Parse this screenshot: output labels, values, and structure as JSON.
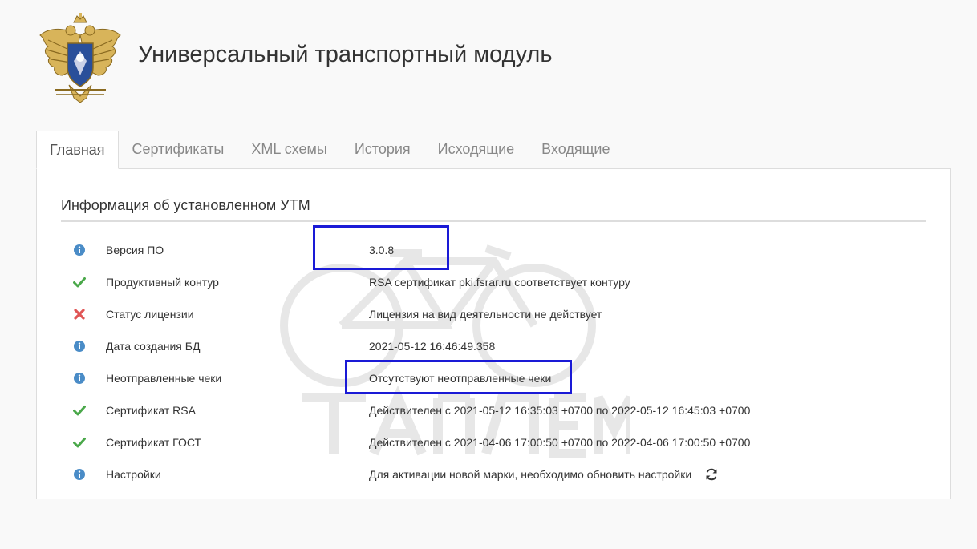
{
  "header": {
    "title": "Универсальный транспортный модуль",
    "emblem_icon": "coat-of-arms-emblem"
  },
  "tabs": [
    {
      "label": "Главная",
      "active": true
    },
    {
      "label": "Сертификаты",
      "active": false
    },
    {
      "label": "XML схемы",
      "active": false
    },
    {
      "label": "История",
      "active": false
    },
    {
      "label": "Исходящие",
      "active": false
    },
    {
      "label": "Входящие",
      "active": false
    }
  ],
  "info": {
    "title": "Информация об установленном УТМ",
    "rows": [
      {
        "icon": "info-icon",
        "label": "Версия ПО",
        "value": "3.0.8"
      },
      {
        "icon": "check-icon",
        "label": "Продуктивный контур",
        "value": "RSA сертификат pki.fsrar.ru соответствует контуру"
      },
      {
        "icon": "cross-icon",
        "label": "Статус лицензии",
        "value": "Лицензия на вид деятельности не действует"
      },
      {
        "icon": "info-icon",
        "label": "Дата создания БД",
        "value": "2021-05-12 16:46:49.358"
      },
      {
        "icon": "info-icon",
        "label": "Неотправленные чеки",
        "value": "Отсутствуют неотправленные чеки"
      },
      {
        "icon": "check-icon",
        "label": "Сертификат RSA",
        "value": "Действителен с 2021-05-12 16:35:03 +0700 по 2022-05-12 16:45:03 +0700"
      },
      {
        "icon": "check-icon",
        "label": "Сертификат ГОСТ",
        "value": "Действителен с 2021-04-06 17:00:50 +0700 по 2022-04-06 17:00:50 +0700"
      },
      {
        "icon": "info-icon",
        "label": "Настройки",
        "value": "Для активации новой марки, необходимо обновить настройки",
        "action_icon": "refresh-icon"
      }
    ]
  },
  "colors": {
    "info": "#4a8cc7",
    "check": "#4aa84a",
    "cross": "#e05555",
    "highlight": "#1a1ad6",
    "border": "#dddddd"
  }
}
